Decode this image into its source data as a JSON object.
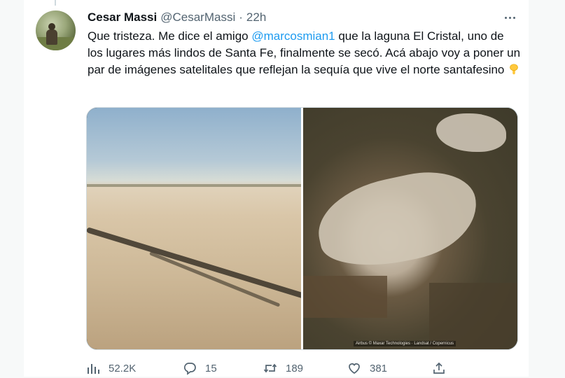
{
  "tweet": {
    "author_name": "Cesar Massi",
    "handle": "@CesarMassi",
    "separator": "·",
    "time": "22h",
    "text_before_mention": "Que tristeza. Me dice el amigo ",
    "mention": "@marcosmian1",
    "text_after_mention": " que la laguna El Cristal, uno de los lugares más lindos de Santa Fe, finalmente se secó. Acá abajo voy a poner un par de imágenes satelitales que reflejan la sequía que vive el norte santafesino ",
    "emoji": "pointing-down-emoji",
    "media": {
      "left_image": "dry-lakebed-photo",
      "right_image": "satellite-image",
      "satellite_caption": "Airbus © Maxar Technologies · Landsat / Copernicus"
    }
  },
  "actions": {
    "views": {
      "icon": "views-icon",
      "count": "52.2K"
    },
    "replies": {
      "icon": "reply-icon",
      "count": "15"
    },
    "retweets": {
      "icon": "retweet-icon",
      "count": "189"
    },
    "likes": {
      "icon": "like-icon",
      "count": "381"
    },
    "share": {
      "icon": "share-icon"
    }
  },
  "colors": {
    "text": "#0f1419",
    "secondary": "#536471",
    "mention": "#1d9bf0",
    "border": "#cfd9de"
  }
}
